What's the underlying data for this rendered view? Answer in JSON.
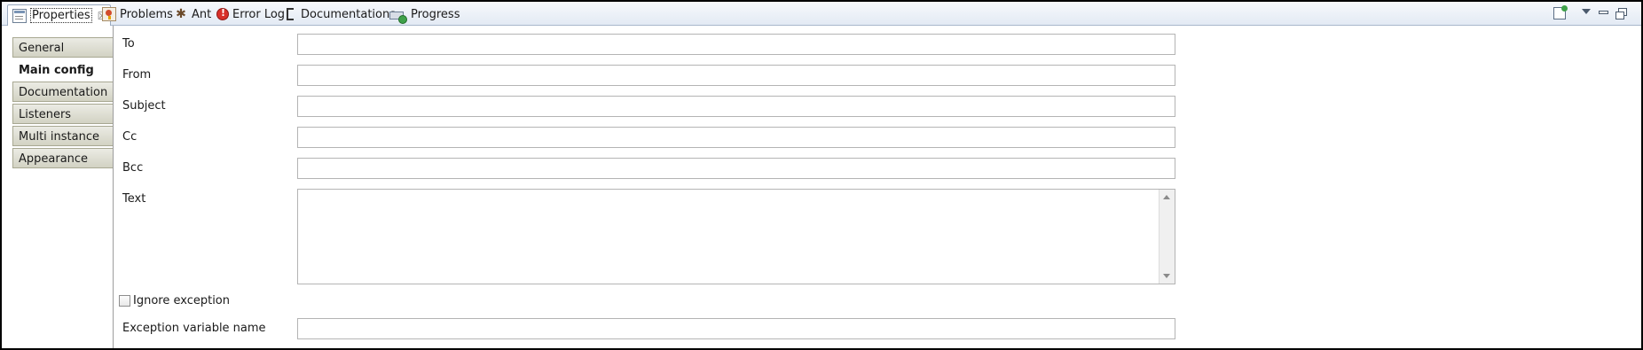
{
  "tabs": [
    {
      "label": "Properties",
      "icon": "properties-icon",
      "active": true
    },
    {
      "label": "Problems",
      "icon": "problems-icon"
    },
    {
      "label": "Ant",
      "icon": "ant-icon"
    },
    {
      "label": "Error Log",
      "icon": "error-log-icon"
    },
    {
      "label": "Documentations",
      "icon": "documentations-icon"
    },
    {
      "label": "Progress",
      "icon": "progress-icon"
    }
  ],
  "close_glyph": "☒",
  "toolbar_icons": [
    "pin-icon",
    "view-menu-icon",
    "minimize-icon",
    "maximize-icon"
  ],
  "sidebar": {
    "items": [
      {
        "label": "General"
      },
      {
        "label": "Main config",
        "selected": true
      },
      {
        "label": "Documentation"
      },
      {
        "label": "Listeners"
      },
      {
        "label": "Multi instance"
      },
      {
        "label": "Appearance"
      }
    ]
  },
  "form": {
    "to": {
      "label": "To",
      "value": ""
    },
    "from": {
      "label": "From",
      "value": ""
    },
    "subject": {
      "label": "Subject",
      "value": ""
    },
    "cc": {
      "label": "Cc",
      "value": ""
    },
    "bcc": {
      "label": "Bcc",
      "value": ""
    },
    "text": {
      "label": "Text",
      "value": ""
    },
    "ignore_exception": {
      "label": "Ignore exception",
      "checked": false
    },
    "exception_variable": {
      "label": "Exception variable name",
      "value": ""
    }
  },
  "colors": {
    "tabbar_bg": "#e3eaf4",
    "side_tab_bg": "#d2d2c3",
    "border": "#b4b4b4"
  }
}
